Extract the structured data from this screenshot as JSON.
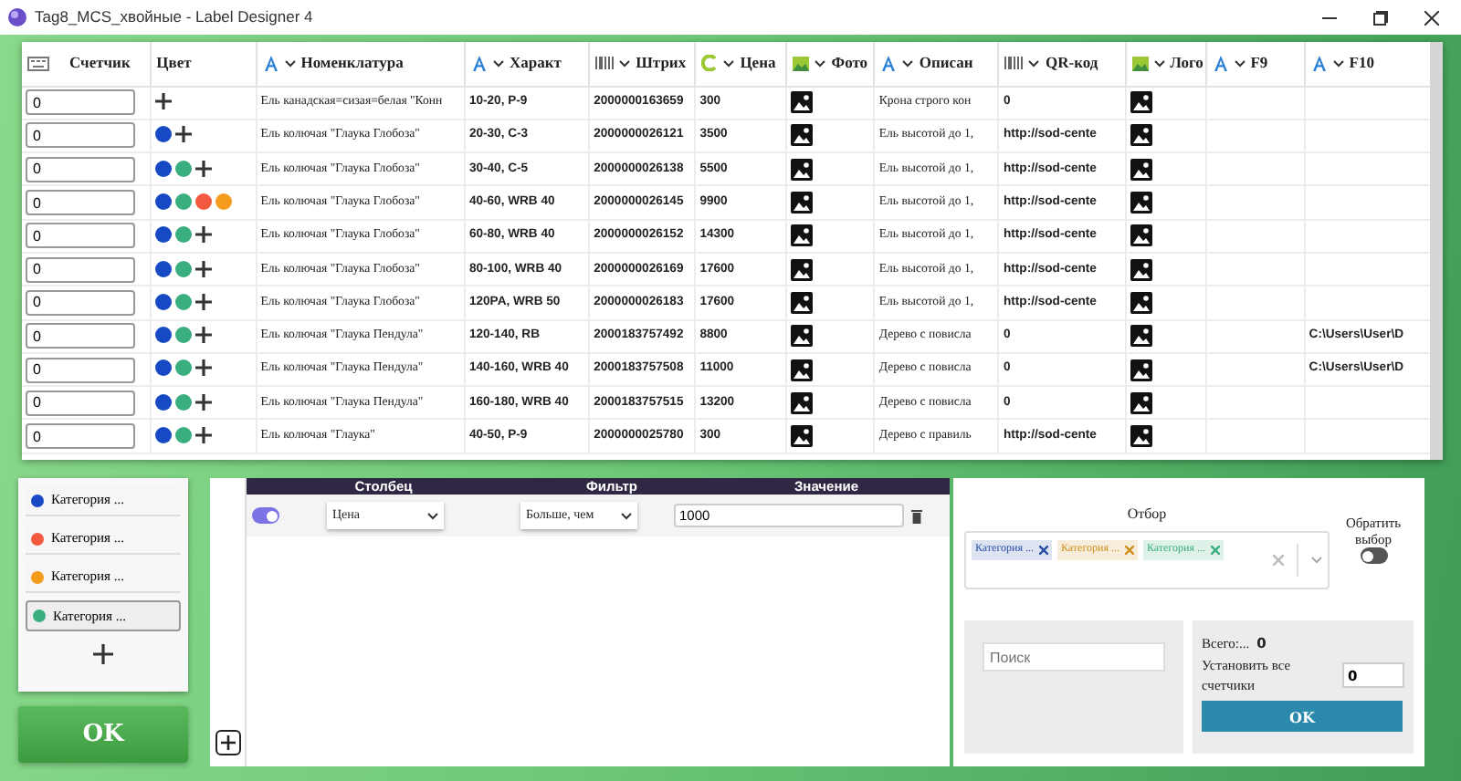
{
  "window": {
    "title": "Tag8_MCS_хвойные - Label Designer 4"
  },
  "table": {
    "columns": [
      {
        "label": "Счетчик",
        "kind": "counter"
      },
      {
        "label": "Цвет",
        "kind": "plain"
      },
      {
        "label": "Номенклатура",
        "kind": "text"
      },
      {
        "label": "Характ",
        "kind": "text"
      },
      {
        "label": "Штрих",
        "kind": "barcode"
      },
      {
        "label": "Цена",
        "kind": "price"
      },
      {
        "label": "Фото",
        "kind": "image"
      },
      {
        "label": "Описан",
        "kind": "text"
      },
      {
        "label": "QR-код",
        "kind": "barcode"
      },
      {
        "label": "Лого",
        "kind": "image"
      },
      {
        "label": "F9",
        "kind": "text"
      },
      {
        "label": "F10",
        "kind": "text"
      }
    ],
    "rows": [
      {
        "counter": "0",
        "colors": [],
        "add": true,
        "name": "Ель канадская=сизая=белая \"Конн",
        "size": "10-20, P-9",
        "barcode": "2000000163659",
        "price": "300",
        "photo": true,
        "description": "Крона строго кон",
        "qr": "0",
        "logo": true
      },
      {
        "counter": "0",
        "colors": [
          {
            "color": "#1749c4"
          }
        ],
        "add": true,
        "name": "Ель колючая \"Глаука Глобоза\"",
        "size": "20-30, C-3",
        "barcode": "2000000026121",
        "price": "3500",
        "photo": true,
        "description": "Ель высотой до 1,",
        "qr": "http://sod-cente",
        "logo": true
      },
      {
        "counter": "0",
        "colors": [
          {
            "color": "#1749c4"
          },
          {
            "color": "#3aae7e"
          }
        ],
        "add": true,
        "name": "Ель колючая \"Глаука Глобоза\"",
        "size": "30-40, C-5",
        "barcode": "2000000026138",
        "price": "5500",
        "photo": true,
        "description": "Ель высотой до 1,",
        "qr": "http://sod-cente",
        "logo": true
      },
      {
        "counter": "0",
        "colors": [
          {
            "color": "#1749c4"
          },
          {
            "color": "#3aae7e"
          },
          {
            "color": "#f2593f"
          },
          {
            "color": "#f59b1d"
          }
        ],
        "add": false,
        "name": "Ель колючая \"Глаука Глобоза\"",
        "size": "40-60, WRB 40",
        "barcode": "2000000026145",
        "price": "9900",
        "photo": true,
        "description": "Ель высотой до 1,",
        "qr": "http://sod-cente",
        "logo": true
      },
      {
        "counter": "0",
        "colors": [
          {
            "color": "#1749c4"
          },
          {
            "color": "#3aae7e"
          }
        ],
        "add": true,
        "name": "Ель колючая \"Глаука Глобоза\"",
        "size": "60-80, WRB 40",
        "barcode": "2000000026152",
        "price": "14300",
        "photo": true,
        "description": "Ель высотой до 1,",
        "qr": "http://sod-cente",
        "logo": true
      },
      {
        "counter": "0",
        "colors": [
          {
            "color": "#1749c4"
          },
          {
            "color": "#3aae7e"
          }
        ],
        "add": true,
        "name": "Ель колючая \"Глаука Глобоза\"",
        "size": "80-100, WRB 40",
        "barcode": "2000000026169",
        "price": "17600",
        "photo": true,
        "description": "Ель высотой до 1,",
        "qr": "http://sod-cente",
        "logo": true
      },
      {
        "counter": "0",
        "colors": [
          {
            "color": "#1749c4"
          },
          {
            "color": "#3aae7e"
          }
        ],
        "add": true,
        "name": "Ель колючая \"Глаука Глобоза\"",
        "size": "120PA, WRB 50",
        "barcode": "2000000026183",
        "price": "17600",
        "photo": true,
        "description": "Ель высотой до 1,",
        "qr": "http://sod-cente",
        "logo": true
      },
      {
        "counter": "0",
        "colors": [
          {
            "color": "#1749c4"
          },
          {
            "color": "#3aae7e"
          }
        ],
        "add": true,
        "name": "Ель колючая \"Глаука Пендула\"",
        "size": "120-140, RB",
        "barcode": "2000183757492",
        "price": "8800",
        "photo": true,
        "description": "Дерево с повисла",
        "qr": "0",
        "logo": true,
        "f10": "C:\\Users\\User\\D"
      },
      {
        "counter": "0",
        "colors": [
          {
            "color": "#1749c4"
          },
          {
            "color": "#3aae7e"
          }
        ],
        "add": true,
        "name": "Ель колючая \"Глаука Пендула\"",
        "size": "140-160, WRB 40",
        "barcode": "2000183757508",
        "price": "11000",
        "photo": true,
        "description": "Дерево с повисла",
        "qr": "0",
        "logo": true,
        "f10": "C:\\Users\\User\\D"
      },
      {
        "counter": "0",
        "colors": [
          {
            "color": "#1749c4"
          },
          {
            "color": "#3aae7e"
          }
        ],
        "add": true,
        "name": "Ель колючая \"Глаука Пендула\"",
        "size": "160-180, WRB 40",
        "barcode": "2000183757515",
        "price": "13200",
        "photo": true,
        "description": "Дерево с повисла",
        "qr": "0",
        "logo": true
      },
      {
        "counter": "0",
        "colors": [
          {
            "color": "#1749c4"
          },
          {
            "color": "#3aae7e"
          }
        ],
        "add": true,
        "name": "Ель колючая \"Глаука\"",
        "size": "40-50, P-9",
        "barcode": "2000000025780",
        "price": "300",
        "photo": true,
        "description": "Дерево с правиль",
        "qr": "http://sod-cente",
        "logo": true
      }
    ]
  },
  "categories": [
    {
      "label": "Категория ...",
      "color": "#1749c4",
      "selected": false
    },
    {
      "label": "Категория ...",
      "color": "#f2593f",
      "selected": false
    },
    {
      "label": "Категория ...",
      "color": "#f59b1d",
      "selected": false
    },
    {
      "label": "Категория ...",
      "color": "#3aae7e",
      "selected": true
    }
  ],
  "ok_button": "OK",
  "filters": {
    "headers": [
      "Столбец",
      "Фильтр",
      "Значение"
    ],
    "rows": [
      {
        "enabled": true,
        "column": "Цена",
        "operator": "Больше, чем",
        "value": "1000"
      }
    ]
  },
  "selection": {
    "label": "Отбор",
    "tags": [
      {
        "label": "Категория ...",
        "color": "#2a4ea8"
      },
      {
        "label": "Категория ...",
        "color": "#d0901c"
      },
      {
        "label": "Категория ...",
        "color": "#3aae7e"
      }
    ],
    "invert_label": "Обратить выбор",
    "invert": false
  },
  "search": {
    "placeholder": "Поиск"
  },
  "totals": {
    "label": "Всего:...",
    "value": "0",
    "set_all_label": "Установить все счетчики",
    "set_all_value": "0",
    "button": "OK"
  }
}
